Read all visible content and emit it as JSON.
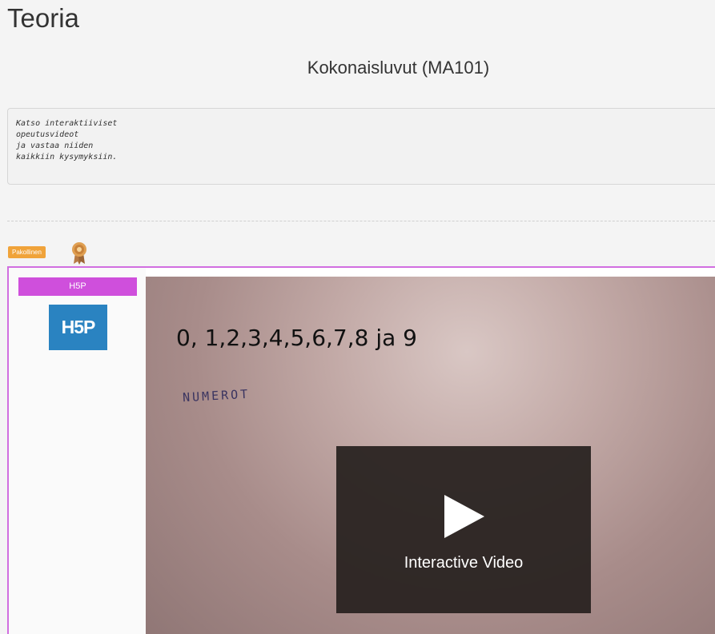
{
  "page": {
    "title": "Teoria",
    "subtitle": "Kokonaisluvut (MA101)"
  },
  "instructions": [
    "Katso interaktiiviset",
    "opeutusvideot",
    "ja vastaa niiden",
    "kaikkiin kysymyksiin."
  ],
  "activity": {
    "badge": "Pakollinen",
    "award_icon": "award-ribbon-icon",
    "type_label": "H5P",
    "logo_text": "H5P",
    "logo_color": "#2a83c1",
    "type_label_color": "#cf4fdc",
    "border_color": "#d16ee0"
  },
  "video": {
    "heading": "0, 1,2,3,4,5,6,7,8 ja 9",
    "scribble": "NUMEROT",
    "play_label": "Interactive Video",
    "play_icon": "play-icon"
  }
}
